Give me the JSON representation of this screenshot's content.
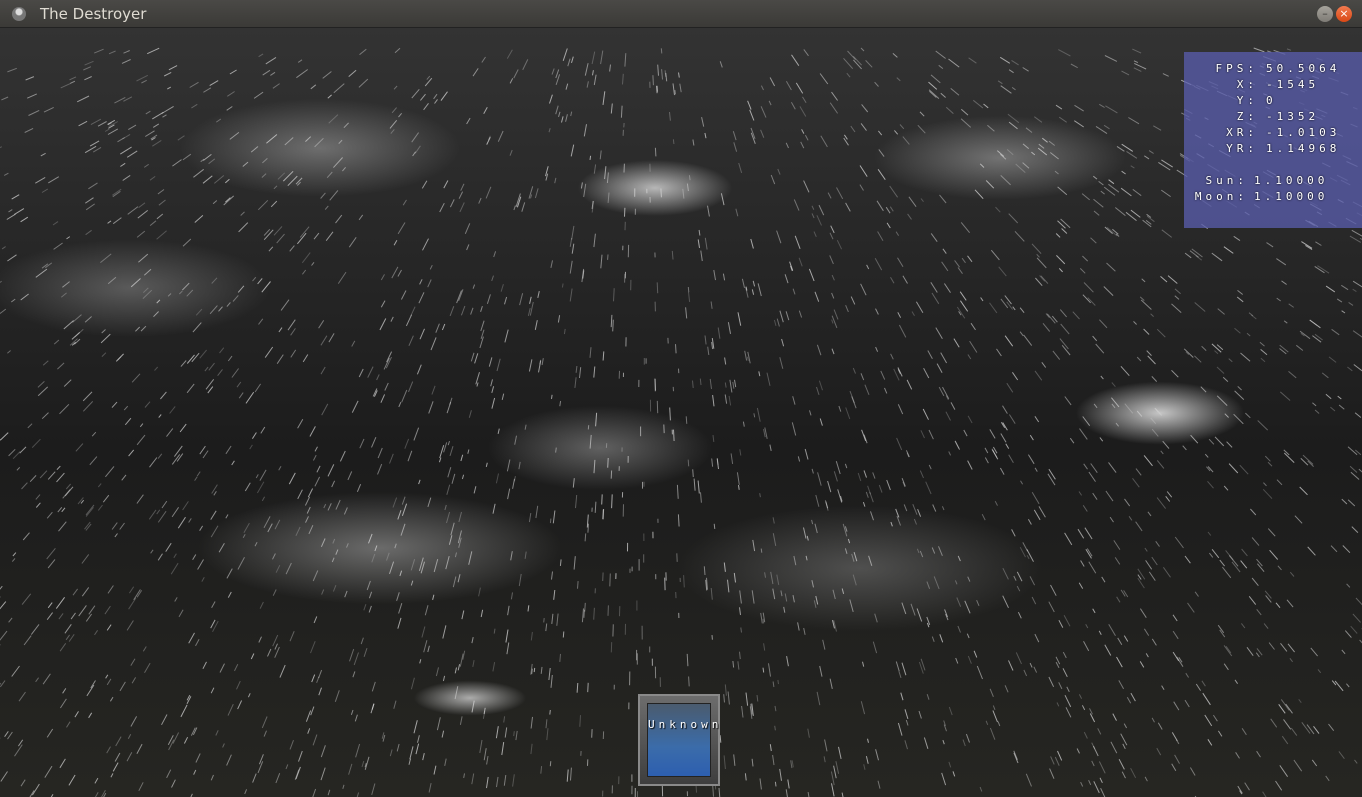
{
  "window": {
    "title": "The Destroyer",
    "minimize_glyph": "–",
    "close_glyph": "×"
  },
  "hud": {
    "stats": [
      {
        "label": "FPS:",
        "value": "50.5064"
      },
      {
        "label": "X:",
        "value": "-1545"
      },
      {
        "label": "Y:",
        "value": "0"
      },
      {
        "label": "Z:",
        "value": "-1352"
      },
      {
        "label": "XR:",
        "value": "-1.0103"
      },
      {
        "label": "YR:",
        "value": "1.14968"
      },
      {
        "label": "Sun:",
        "value": "1.10000"
      },
      {
        "label": "Moon:",
        "value": "1.10000"
      }
    ],
    "panel_color": "#585caa"
  },
  "inventory": {
    "selected_item": "Unknown"
  },
  "scene": {
    "weather": "rain",
    "colors": {
      "rain": "#d8d8d8",
      "sky": "#1c1c1c"
    }
  }
}
